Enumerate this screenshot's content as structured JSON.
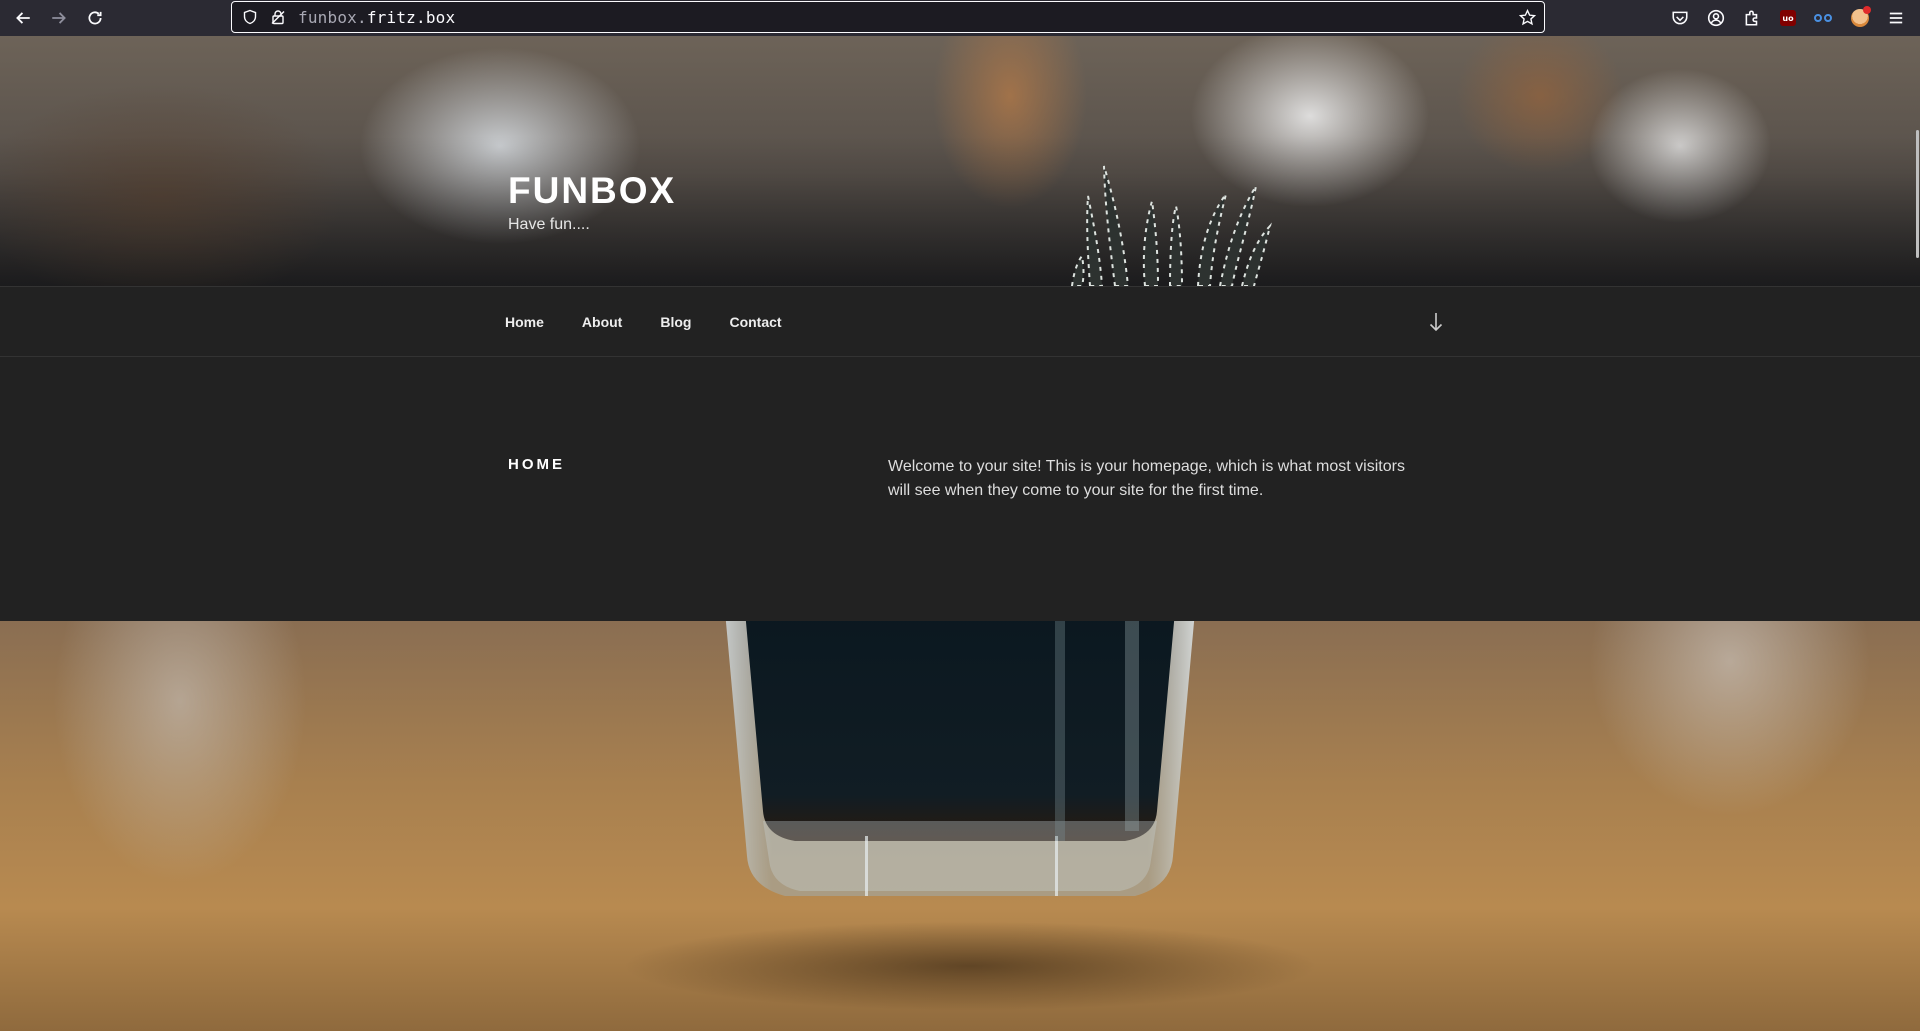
{
  "browser": {
    "url_prefix": "funbox.",
    "url_domain": "fritz.box",
    "icons": [
      "back-arrow-icon",
      "forward-arrow-icon",
      "reload-icon",
      "shield-icon",
      "lock-icon",
      "star-icon",
      "pocket-icon",
      "account-icon",
      "extensions-icon",
      "ublock-icon",
      "glasses-icon",
      "face-extension-icon",
      "menu-icon"
    ],
    "ublock_label": "uo"
  },
  "site": {
    "title": "FUNBOX",
    "tagline": "Have fun...."
  },
  "nav": {
    "items": [
      {
        "label": "Home"
      },
      {
        "label": "About"
      },
      {
        "label": "Blog"
      },
      {
        "label": "Contact"
      }
    ]
  },
  "page": {
    "title": "HOME",
    "body": "Welcome to your site! This is your homepage, which is what most visitors will see when they come to your site for the first time."
  },
  "colors": {
    "page_background": "#222222",
    "chrome_background": "#2b2a33",
    "urlbar_background": "#1c1b22",
    "text_primary": "#ffffff"
  }
}
